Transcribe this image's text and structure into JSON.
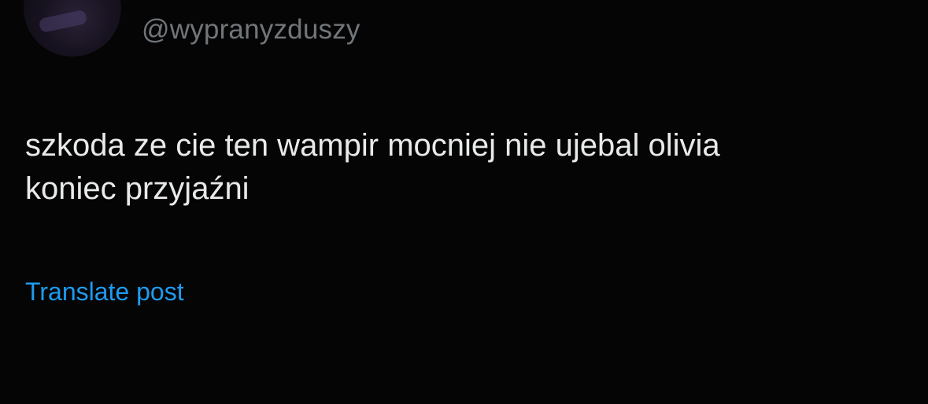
{
  "post": {
    "handle": "@wypranyzduszy",
    "text_lines": [
      "szkoda ze cie ten wampir mocniej nie ujebal olivia",
      "koniec przyjaźni"
    ],
    "translate_label": "Translate post"
  },
  "colors": {
    "background": "#050505",
    "text": "#e7e9ea",
    "handle": "#71767b",
    "link": "#1d9bf0"
  }
}
